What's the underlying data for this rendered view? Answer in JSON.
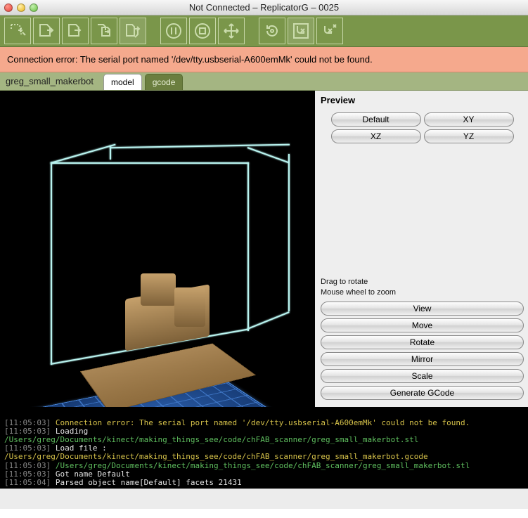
{
  "window": {
    "title": "Not Connected – ReplicatorG – 0025"
  },
  "error": {
    "message": "Connection error: The serial port named '/dev/tty.usbserial-A600emMk' could not be found."
  },
  "file": {
    "name": "greg_small_makerbot"
  },
  "tabs": {
    "model": "model",
    "gcode": "gcode"
  },
  "preview": {
    "heading": "Preview",
    "default": "Default",
    "xy": "XY",
    "xz": "XZ",
    "yz": "YZ",
    "hint1": "Drag to rotate",
    "hint2": "Mouse wheel to zoom",
    "view": "View",
    "move": "Move",
    "rotate": "Rotate",
    "mirror": "Mirror",
    "scale": "Scale",
    "generate": "Generate GCode"
  },
  "console": {
    "l0_ts": "[11:05:03]",
    "l0_txt": " Connection error: The serial port named '/dev/tty.usbserial-A600emMk' could not be found.",
    "l1_ts": "[11:05:03]",
    "l1_txt": " Loading ",
    "l1_path": "/Users/greg/Documents/kinect/making_things_see/code/chFAB_scanner/greg_small_makerbot.stl",
    "l2_ts": "[11:05:03]",
    "l2_txt": " Load file : ",
    "l2_path": "/Users/greg/Documents/kinect/making_things_see/code/chFAB_scanner/greg_small_makerbot.gcode",
    "l3_ts": "[11:05:03]",
    "l3_txt": " /Users/greg/Documents/kinect/making_things_see/code/chFAB_scanner/greg_small_makerbot.stl",
    "l4_ts": "[11:05:03]",
    "l4_txt": " Got name Default",
    "l5_ts": "[11:05:04]",
    "l5_txt": " Parsed object name[Default] facets 21431"
  },
  "toolbar_icons": [
    "new",
    "open",
    "save",
    "export",
    "build",
    "pause",
    "stop",
    "move-tool",
    "reset",
    "control-panel",
    "disconnect"
  ]
}
